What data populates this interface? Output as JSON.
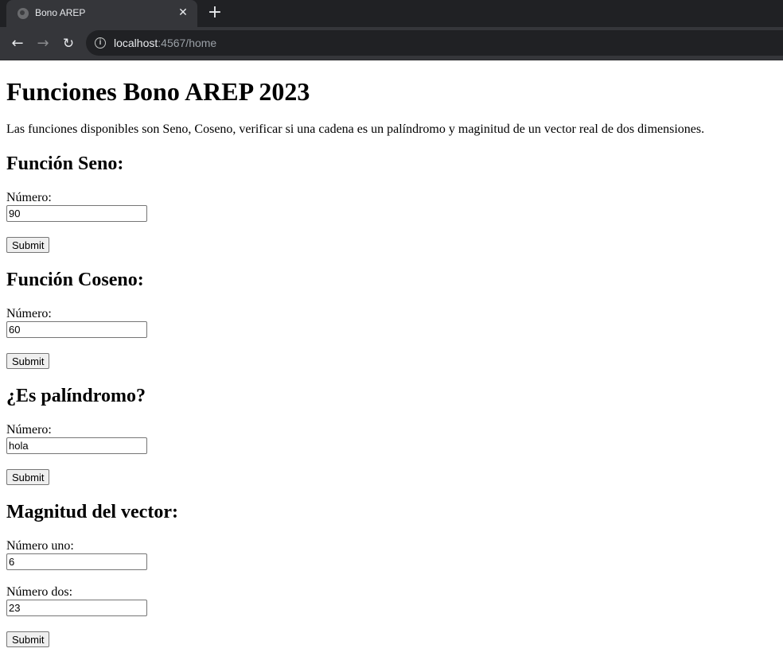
{
  "browser": {
    "tab_title": "Bono AREP",
    "tab_close_glyph": "✕",
    "new_tab_glyph": "+",
    "back_glyph": "←",
    "forward_glyph": "→",
    "reload_glyph": "↻",
    "info_glyph": "i",
    "url_host": "localhost",
    "url_path": ":4567/home"
  },
  "page": {
    "title": "Funciones Bono AREP 2023",
    "intro": "Las funciones disponibles son Seno, Coseno, verificar si una cadena es un palíndromo y maginitud de un vector real de dos dimensiones.",
    "sections": [
      {
        "heading": "Función Seno:",
        "fields": [
          {
            "label": "Número:",
            "value": "90"
          }
        ],
        "submit": "Submit"
      },
      {
        "heading": "Función Coseno:",
        "fields": [
          {
            "label": "Número:",
            "value": "60"
          }
        ],
        "submit": "Submit"
      },
      {
        "heading": "¿Es palíndromo?",
        "fields": [
          {
            "label": "Número:",
            "value": "hola"
          }
        ],
        "submit": "Submit"
      },
      {
        "heading": "Magnitud del vector:",
        "fields": [
          {
            "label": "Número uno:",
            "value": "6"
          },
          {
            "label": "Número dos:",
            "value": "23"
          }
        ],
        "submit": "Submit"
      }
    ]
  },
  "colors": {
    "chrome_dark": "#202124",
    "chrome_tab": "#35363a",
    "chrome_text": "#e8eaed",
    "page_background": "#ffffff"
  }
}
